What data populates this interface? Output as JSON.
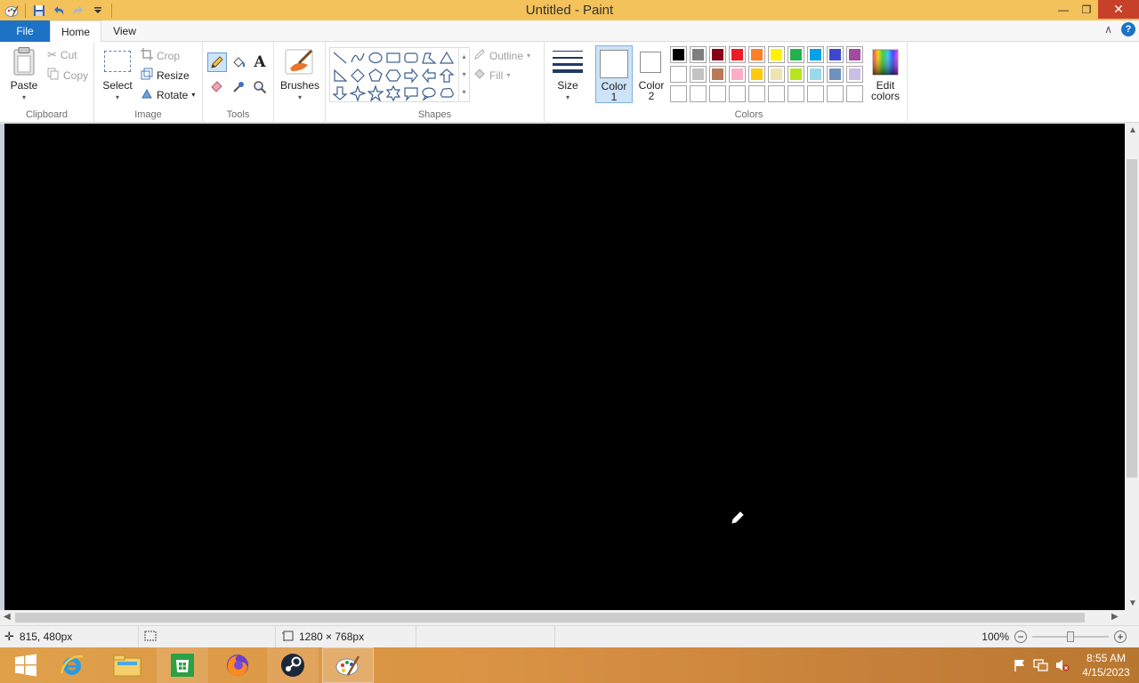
{
  "window": {
    "title": "Untitled - Paint",
    "minimize_glyph": "—",
    "restore_glyph": "❐",
    "close_glyph": "✕"
  },
  "tabs": {
    "file": "File",
    "home": "Home",
    "view": "View",
    "collapse_glyph": "∧",
    "help_glyph": "?"
  },
  "clipboard": {
    "paste": "Paste",
    "cut": "Cut",
    "copy": "Copy",
    "label": "Clipboard"
  },
  "image_group": {
    "select": "Select",
    "crop": "Crop",
    "resize": "Resize",
    "rotate": "Rotate",
    "label": "Image"
  },
  "tools": {
    "label": "Tools",
    "text_glyph": "A"
  },
  "brushes": {
    "label": "Brushes"
  },
  "shapes": {
    "label": "Shapes",
    "outline": "Outline",
    "fill": "Fill"
  },
  "size": {
    "label": "Size"
  },
  "colors": {
    "color1_line1": "Color",
    "color1_line2": "1",
    "color2_line1": "Color",
    "color2_line2": "2",
    "edit_line1": "Edit",
    "edit_line2": "colors",
    "label": "Colors",
    "row1": [
      "#000000",
      "#7f7f7f",
      "#880015",
      "#ed1c24",
      "#ff7f27",
      "#fff200",
      "#22b14c",
      "#00a2e8",
      "#3f48cc",
      "#a349a4"
    ],
    "row2": [
      "#ffffff",
      "#c3c3c3",
      "#b97a57",
      "#ffaec9",
      "#ffc90e",
      "#efe4b0",
      "#b5e61d",
      "#99d9ea",
      "#7092be",
      "#c8bfe7"
    ],
    "row3": [
      "#ffffff",
      "#ffffff",
      "#ffffff",
      "#ffffff",
      "#ffffff",
      "#ffffff",
      "#ffffff",
      "#ffffff",
      "#ffffff",
      "#ffffff"
    ],
    "color1": "#ffffff",
    "color2": "#ffffff"
  },
  "status": {
    "cursor_pos": "815, 480px",
    "canvas_size": "1280 × 768px",
    "zoom": "100%",
    "zoom_fraction": 0.5
  },
  "taskbar": {
    "time": "8:55 AM",
    "date": "4/15/2023"
  }
}
